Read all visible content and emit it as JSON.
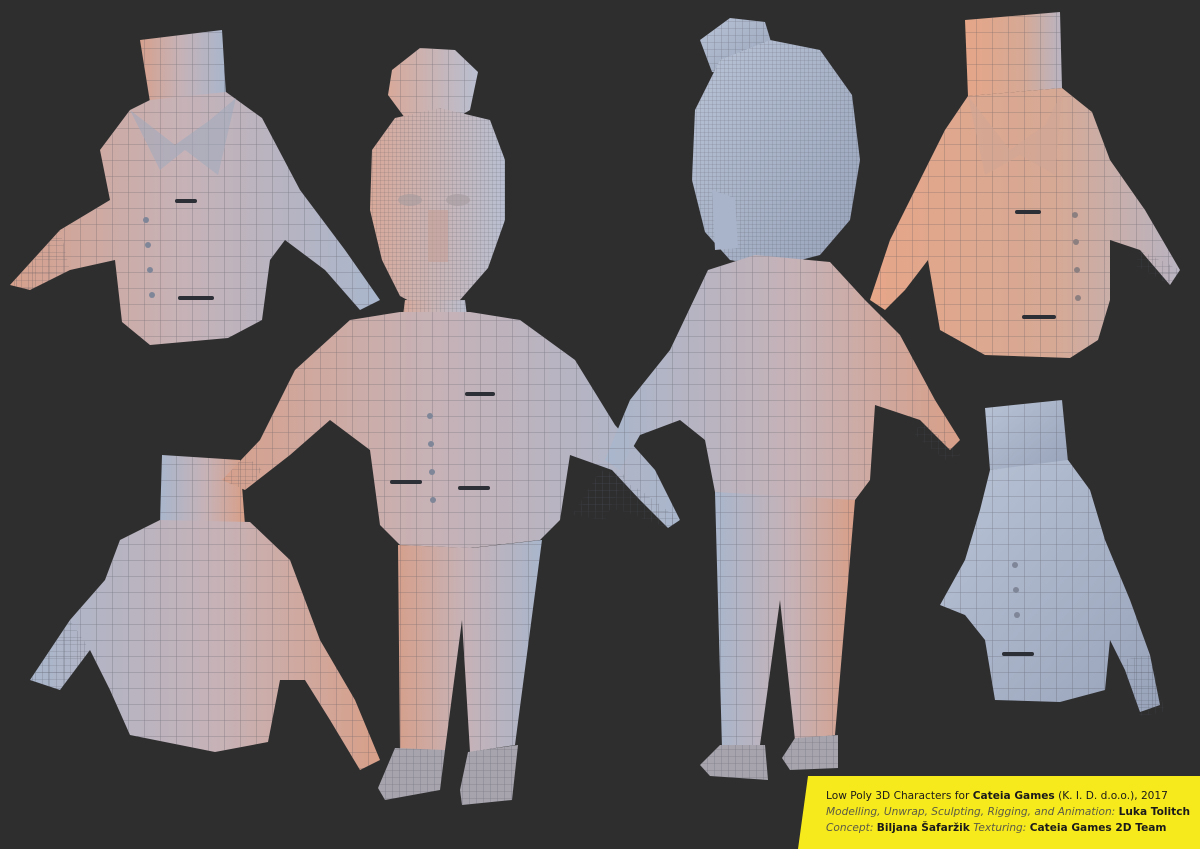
{
  "colors": {
    "background": "#2e2e2f",
    "banner": "#f7ea1c",
    "mesh_cool": "#aeb8cc",
    "mesh_warm": "#d9a48e",
    "wire": "#4a4c55"
  },
  "credits": {
    "line1_prefix": "Low Poly 3D Characters for ",
    "line1_studio": "Cateia Games",
    "line1_suffix": " (K. I. D. d.o.o.), 2017",
    "line2_role": "Modelling, Unwrap, Sculpting, Rigging, and Animation: ",
    "line2_name": "Luka Tolitch",
    "line3_concept_role": "Concept: ",
    "line3_concept_name": "Biljana Šafaržik",
    "line3_texturing_role": " Texturing: ",
    "line3_texturing_name": "Cateia Games 2D Team"
  },
  "scene": {
    "models": [
      "torso-front-left",
      "torso-back-left",
      "character-front",
      "character-back",
      "torso-front-right",
      "torso-side-right"
    ]
  }
}
